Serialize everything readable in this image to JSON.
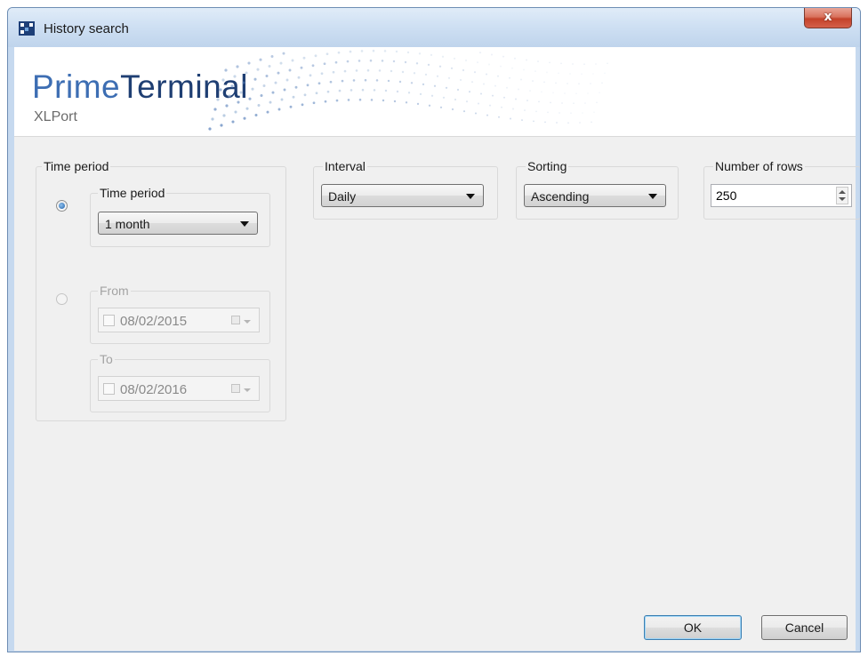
{
  "window": {
    "title": "History search",
    "close_label": "x",
    "app_icon": "grid-app-icon"
  },
  "banner": {
    "brand_prime": "Prime",
    "brand_terminal": "Terminal",
    "subtitle": "XLPort"
  },
  "time_period_group": {
    "label": "Time period",
    "preset": {
      "selected": true,
      "label": "Time period",
      "value": "1 month"
    },
    "range": {
      "selected": false,
      "from_label": "From",
      "from_value": "08/02/2015",
      "to_label": "To",
      "to_value": "08/02/2016"
    }
  },
  "interval": {
    "label": "Interval",
    "value": "Daily"
  },
  "sorting": {
    "label": "Sorting",
    "value": "Ascending"
  },
  "rows": {
    "label": "Number of rows",
    "value": "250"
  },
  "buttons": {
    "ok": "OK",
    "cancel": "Cancel"
  },
  "colors": {
    "brand_light": "#3d6eb3",
    "brand_dark": "#1f3f73",
    "close_red": "#c4422a",
    "titlebar": "#cfe0f3"
  }
}
